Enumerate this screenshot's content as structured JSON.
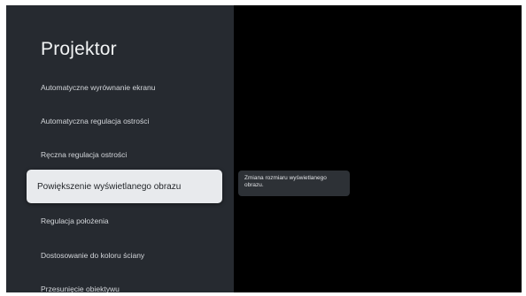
{
  "panel": {
    "title": "Projektor",
    "items": [
      {
        "label": "Automatyczne wyrównanie ekranu",
        "selected": false
      },
      {
        "label": "Automatyczna regulacja ostrości",
        "selected": false
      },
      {
        "label": "Ręczna regulacja ostrości",
        "selected": false
      },
      {
        "label": "Powiększenie wyświetlanego obrazu",
        "selected": true
      },
      {
        "label": "Regulacja położenia",
        "selected": false
      },
      {
        "label": "Dostosowanie do koloru ściany",
        "selected": false
      },
      {
        "label": "Przesunięcie obiektywu",
        "selected": false
      }
    ]
  },
  "tooltip": {
    "text": "Zmiana rozmiaru wyświetlanego obrazu."
  },
  "colors": {
    "panel_background": "#262a30",
    "screen_background": "#000000",
    "selected_item_background": "#e8eaed"
  }
}
